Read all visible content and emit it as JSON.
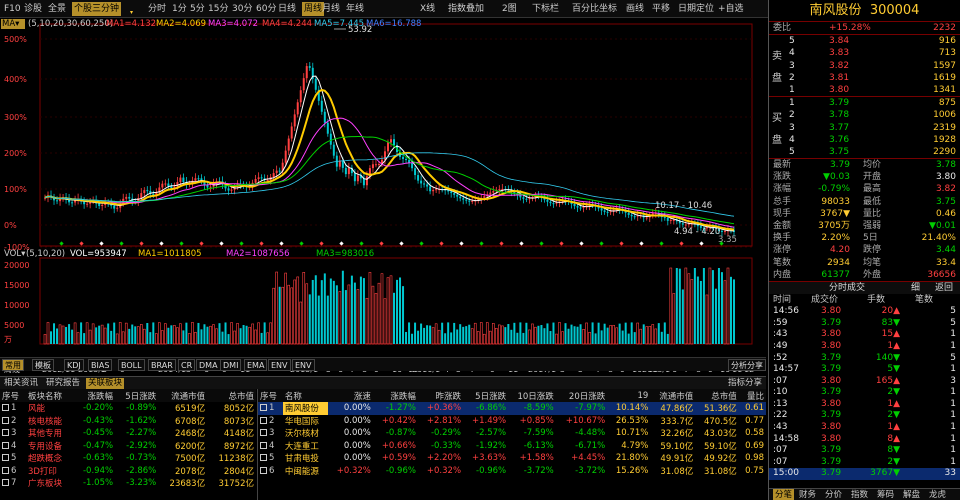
{
  "toolbar": {
    "f10": "F10",
    "diagnose": "诊股",
    "all": "全景",
    "tip": "个股三分钟",
    "periods": [
      "分时",
      "1分",
      "5分",
      "15分",
      "30分",
      "60分",
      "日线",
      "周线",
      "月线",
      "年线"
    ],
    "selected_period": "周线",
    "more_btn": "▾",
    "adjust": "X线",
    "indicator_add": "指数叠加",
    "two_charts": "2图",
    "cursor": "下标栏",
    "compare": "百分比坐标",
    "draw": "画线",
    "flat": "平移",
    "date_locate": "日期定位",
    "watchlist": "+自选"
  },
  "chart_legend": {
    "ma_tag": "MA▾",
    "ma_params": "(5,10,20,30,60,250)",
    "ma1": "MA1=4.132",
    "ma2": "MA2=4.069",
    "ma3": "MA3=4.072",
    "ma4": "MA4=4.244",
    "ma5": "MA5=7.445",
    "ma6": "MA6=16.788",
    "high_label": "53.92",
    "mid_label": "10.17 - 10.46",
    "low_label": "4.94 - 4.20",
    "last_label": "3.35"
  },
  "y_axis": [
    "500%",
    "400%",
    "300%",
    "200%",
    "100%",
    "0%",
    "-100%"
  ],
  "vol_legend": {
    "tag": "VOL▾",
    "params": "(5,10,20)",
    "vol": "VOL=953947",
    "ma1": "MA1=1011805",
    "ma2": "MA2=1087656",
    "ma3": "MA3=983016"
  },
  "vol_axis": [
    "20000",
    "15000",
    "10000",
    "5000",
    "万"
  ],
  "x_axis": [
    "周线",
    "2012/11",
    "2013/2",
    "6",
    "9",
    "2014/1",
    "3",
    "6",
    "9",
    "11",
    "2015/1",
    "5",
    "6",
    "7",
    "8",
    "9",
    "10",
    "11",
    "2016/1",
    "4",
    "5",
    "7",
    "9",
    "11",
    "2017/1",
    "3",
    "5",
    "7",
    "8",
    "9",
    "10",
    "11",
    "2018/1",
    "6",
    "7",
    "8",
    "9",
    "10",
    "11",
    "12"
  ],
  "sub_tabs": {
    "common": "常用",
    "template": "模板",
    "items": [
      "KDJ",
      "BIAS",
      "BOLL",
      "BRAR",
      "CR",
      "DMA",
      "DMI",
      "EMA",
      "ENV",
      "ENV"
    ],
    "share": "分析分享"
  },
  "bottom_tabs": {
    "news": "相关资讯",
    "report": "研究报告",
    "sector": "关联板块",
    "indicator": "指标分享"
  },
  "sectors": {
    "headers": [
      "序号",
      "板块名称",
      "涨跌幅",
      "5日涨跌",
      "流通市值",
      "总市值"
    ],
    "rows": [
      {
        "no": "1",
        "name": "风能",
        "chg": "-0.20%",
        "chg5": "-0.89%",
        "float": "6519亿",
        "total": "8052亿"
      },
      {
        "no": "2",
        "name": "核电核能",
        "chg": "-0.43%",
        "chg5": "-1.62%",
        "float": "6708亿",
        "total": "8073亿"
      },
      {
        "no": "3",
        "name": "其他专用",
        "chg": "-0.45%",
        "chg5": "-2.27%",
        "float": "2468亿",
        "total": "4148亿"
      },
      {
        "no": "4",
        "name": "专用设备",
        "chg": "-0.47%",
        "chg5": "-2.92%",
        "float": "6200亿",
        "total": "8972亿"
      },
      {
        "no": "5",
        "name": "超跌概念",
        "chg": "-0.63%",
        "chg5": "-0.73%",
        "float": "7500亿",
        "total": "11238亿"
      },
      {
        "no": "6",
        "name": "3D打印",
        "chg": "-0.94%",
        "chg5": "-2.86%",
        "float": "2078亿",
        "total": "2804亿"
      },
      {
        "no": "7",
        "name": "广东板块",
        "chg": "-1.05%",
        "chg5": "-3.23%",
        "float": "23683亿",
        "total": "31752亿"
      }
    ]
  },
  "stocks": {
    "headers": [
      "序号",
      "名称",
      "涨速",
      "涨跌幅",
      "昨涨跌",
      "5日涨跌",
      "10日涨跌",
      "20日涨跌",
      "19",
      "流通市值",
      "总市值",
      "量比"
    ],
    "rows": [
      {
        "no": "1",
        "name": "南风股份",
        "speed": "0.00%",
        "chg": "-1.27%",
        "ychg": "+0.36%",
        "c5": "-6.86%",
        "c10": "-8.59%",
        "c20": "-7.97%",
        "v19": "10.14%",
        "float": "47.86亿",
        "total": "51.36亿",
        "ratio": "0.61"
      },
      {
        "no": "2",
        "name": "华电国际",
        "speed": "0.00%",
        "chg": "+0.42%",
        "ychg": "+2.81%",
        "c5": "+1.49%",
        "c10": "+0.85%",
        "c20": "+10.67%",
        "v19": "26.53%",
        "float": "333.7亿",
        "total": "470.5亿",
        "ratio": "0.77"
      },
      {
        "no": "3",
        "name": "沃尔核材",
        "speed": "0.00%",
        "chg": "-0.87%",
        "ychg": "-0.29%",
        "c5": "-2.57%",
        "c10": "-7.59%",
        "c20": "-4.48%",
        "v19": "10.71%",
        "float": "32.26亿",
        "total": "43.03亿",
        "ratio": "0.58"
      },
      {
        "no": "4",
        "name": "大连重工",
        "speed": "0.00%",
        "chg": "+0.66%",
        "ychg": "-0.33%",
        "c5": "-1.92%",
        "c10": "-6.13%",
        "c20": "-6.71%",
        "v19": "4.79%",
        "float": "59.10亿",
        "total": "59.10亿",
        "ratio": "0.69"
      },
      {
        "no": "5",
        "name": "甘肃电投",
        "speed": "0.00%",
        "chg": "+0.59%",
        "ychg": "+2.20%",
        "c5": "+3.63%",
        "c10": "+1.58%",
        "c20": "+4.45%",
        "v19": "21.80%",
        "float": "49.91亿",
        "total": "49.92亿",
        "ratio": "0.98"
      },
      {
        "no": "6",
        "name": "中闽能源",
        "speed": "+0.32%",
        "chg": "-0.96%",
        "ychg": "+0.32%",
        "c5": "-0.96%",
        "c10": "-3.72%",
        "c20": "-3.72%",
        "v19": "15.26%",
        "float": "31.08亿",
        "total": "31.08亿",
        "ratio": "0.75"
      }
    ]
  },
  "quote": {
    "name": "南风股份",
    "code": "300004",
    "ratio_label": "委比",
    "ratio": "+15.28%",
    "ratio_val": "2232",
    "sell_label": [
      "卖",
      "盘"
    ],
    "buy_label": [
      "买",
      "盘"
    ],
    "asks": [
      {
        "lvl": "5",
        "price": "3.84",
        "vol": "916"
      },
      {
        "lvl": "4",
        "price": "3.83",
        "vol": "713"
      },
      {
        "lvl": "3",
        "price": "3.82",
        "vol": "1597"
      },
      {
        "lvl": "2",
        "price": "3.81",
        "vol": "1619"
      },
      {
        "lvl": "1",
        "price": "3.80",
        "vol": "1341"
      }
    ],
    "bids": [
      {
        "lvl": "1",
        "price": "3.79",
        "vol": "875"
      },
      {
        "lvl": "2",
        "price": "3.78",
        "vol": "1006"
      },
      {
        "lvl": "3",
        "price": "3.77",
        "vol": "2319"
      },
      {
        "lvl": "4",
        "price": "3.76",
        "vol": "1928"
      },
      {
        "lvl": "5",
        "price": "3.75",
        "vol": "2290"
      }
    ],
    "stats": [
      {
        "l1": "最新",
        "v1": "3.79",
        "c1": "green",
        "l2": "均价",
        "v2": "3.78",
        "c2": "green"
      },
      {
        "l1": "涨跌",
        "v1": "▼0.03",
        "c1": "green",
        "l2": "开盘",
        "v2": "3.80",
        "c2": "white"
      },
      {
        "l1": "涨幅",
        "v1": "-0.79%",
        "c1": "green",
        "l2": "最高",
        "v2": "3.82",
        "c2": "red"
      },
      {
        "l1": "总手",
        "v1": "98033",
        "c1": "yellow",
        "l2": "最低",
        "v2": "3.75",
        "c2": "green"
      },
      {
        "l1": "现手",
        "v1": "3767▼",
        "c1": "yellow",
        "l2": "量比",
        "v2": "0.46",
        "c2": "yellow"
      },
      {
        "l1": "金额",
        "v1": "3705万",
        "c1": "yellow",
        "l2": "强弱",
        "v2": "▼0.01",
        "c2": "green"
      },
      {
        "l1": "换手",
        "v1": "2.20%",
        "c1": "yellow",
        "l2": "5日",
        "v2": "21.40%",
        "c2": "yellow"
      },
      {
        "l1": "涨停",
        "v1": "4.20",
        "c1": "red",
        "l2": "跌停",
        "v2": "3.44",
        "c2": "green"
      },
      {
        "l1": "笔数",
        "v1": "2934",
        "c1": "yellow",
        "l2": "均笔",
        "v2": "33.4",
        "c2": "yellow"
      },
      {
        "l1": "内盘",
        "v1": "61377",
        "c1": "green",
        "l2": "外盘",
        "v2": "36656",
        "c2": "red"
      }
    ],
    "tick_title": "分时成交",
    "tick_fine": "细",
    "tick_back": "返回",
    "tick_headers": [
      "时间",
      "成交价",
      "手数",
      "笔数"
    ],
    "ticks": [
      {
        "t": "14:56",
        "p": "3.80",
        "pc": "red",
        "v": "20▲",
        "vc": "red",
        "n": "5"
      },
      {
        "t": ":59",
        "p": "3.79",
        "pc": "green",
        "v": "83▼",
        "vc": "green",
        "n": "5"
      },
      {
        "t": ":43",
        "p": "3.80",
        "pc": "red",
        "v": "15▲",
        "vc": "red",
        "n": "1"
      },
      {
        "t": ":49",
        "p": "3.80",
        "pc": "red",
        "v": "1▲",
        "vc": "red",
        "n": "1"
      },
      {
        "t": ":52",
        "p": "3.79",
        "pc": "green",
        "v": "140▼",
        "vc": "green",
        "n": "5"
      },
      {
        "t": "14:57",
        "p": "3.79",
        "pc": "green",
        "v": "5▼",
        "vc": "green",
        "n": "1"
      },
      {
        "t": ":07",
        "p": "3.80",
        "pc": "red",
        "v": "165▲",
        "vc": "red",
        "n": "3"
      },
      {
        "t": ":10",
        "p": "3.79",
        "pc": "green",
        "v": "2▼",
        "vc": "green",
        "n": "1"
      },
      {
        "t": ":13",
        "p": "3.80",
        "pc": "red",
        "v": "1▲",
        "vc": "red",
        "n": "1"
      },
      {
        "t": ":22",
        "p": "3.79",
        "pc": "green",
        "v": "2▼",
        "vc": "green",
        "n": "1"
      },
      {
        "t": ":43",
        "p": "3.80",
        "pc": "red",
        "v": "1▲",
        "vc": "red",
        "n": "1"
      },
      {
        "t": "14:58",
        "p": "3.80",
        "pc": "red",
        "v": "8▲",
        "vc": "red",
        "n": "1"
      },
      {
        "t": ":07",
        "p": "3.79",
        "pc": "green",
        "v": "8▼",
        "vc": "green",
        "n": "1"
      },
      {
        "t": ":07",
        "p": "3.79",
        "pc": "green",
        "v": "2▼",
        "vc": "green",
        "n": "1"
      },
      {
        "t": "15:00",
        "p": "3.79",
        "pc": "green",
        "v": "3767▼",
        "vc": "green",
        "n": "33"
      }
    ],
    "tabs": [
      "分笔",
      "财务",
      "分价",
      "指数",
      "筹码",
      "解盘",
      "龙虎"
    ]
  },
  "colors": {
    "up": "#ff4040",
    "down": "#00d0d0",
    "ma1": "#ffffff",
    "ma2": "#ffcc00",
    "ma3": "#ff40ff",
    "ma4": "#00d000",
    "ma5": "#4080ff",
    "ma6": "#60c060"
  }
}
